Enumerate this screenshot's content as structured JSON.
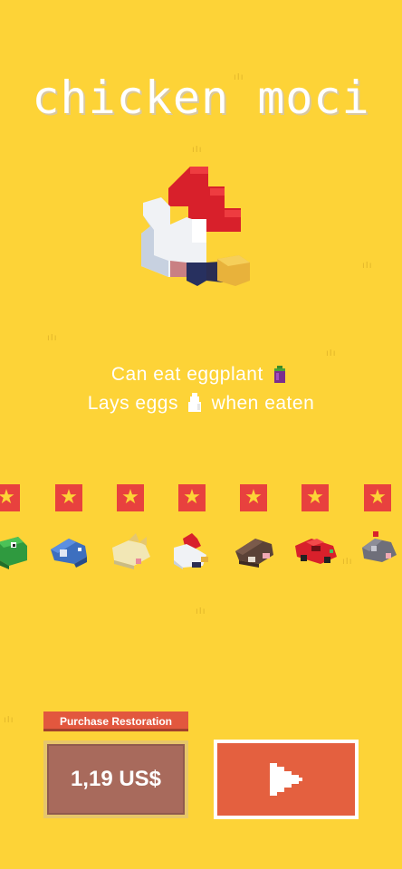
{
  "title": "chicken moci",
  "character": {
    "ability_line1": "Can eat eggplant",
    "ability_line2_before": "Lays eggs",
    "ability_line2_after": "when eaten",
    "eggplant_icon": "eggplant-icon",
    "egg_icon": "egg-icon"
  },
  "carousel": {
    "star_icon": "★",
    "characters": [
      "green-frog",
      "blue-bird",
      "yellow-cat",
      "chicken",
      "brown-mole",
      "red-car",
      "gray-mouse"
    ]
  },
  "purchase": {
    "restoration_label": "Purchase Restoration",
    "price": "1,19 US$"
  },
  "play_icon": "play-icon",
  "colors": {
    "background": "#fdd337",
    "button_red": "#e4603f",
    "price_bg": "#a86a5c",
    "star_red": "#e8413e"
  }
}
